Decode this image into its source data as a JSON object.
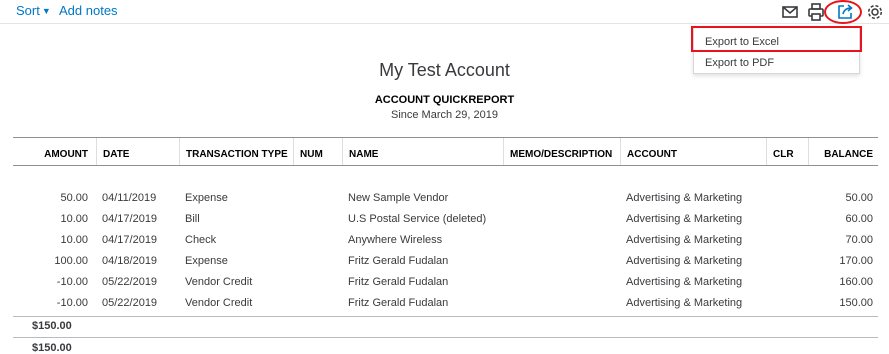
{
  "toolbar": {
    "sort_label": "Sort",
    "add_notes_label": "Add notes"
  },
  "dropdown": {
    "export_excel": "Export to Excel",
    "export_pdf": "Export to PDF"
  },
  "report": {
    "company": "My Test Account",
    "title": "ACCOUNT QUICKREPORT",
    "date_range": "Since March 29, 2019"
  },
  "table": {
    "columns": [
      "AMOUNT",
      "DATE",
      "TRANSACTION TYPE",
      "NUM",
      "NAME",
      "MEMO/DESCRIPTION",
      "ACCOUNT",
      "CLR",
      "BALANCE"
    ],
    "rows": [
      {
        "amount": "50.00",
        "date": "04/11/2019",
        "type": "Expense",
        "num": "",
        "name": "New Sample Vendor",
        "memo": "",
        "account": "Advertising & Marketing",
        "clr": "",
        "balance": "50.00"
      },
      {
        "amount": "10.00",
        "date": "04/17/2019",
        "type": "Bill",
        "num": "",
        "name": "U.S Postal Service (deleted)",
        "memo": "",
        "account": "Advertising & Marketing",
        "clr": "",
        "balance": "60.00"
      },
      {
        "amount": "10.00",
        "date": "04/17/2019",
        "type": "Check",
        "num": "",
        "name": "Anywhere Wireless",
        "memo": "",
        "account": "Advertising & Marketing",
        "clr": "",
        "balance": "70.00"
      },
      {
        "amount": "100.00",
        "date": "04/18/2019",
        "type": "Expense",
        "num": "",
        "name": "Fritz Gerald Fudalan",
        "memo": "",
        "account": "Advertising & Marketing",
        "clr": "",
        "balance": "170.00"
      },
      {
        "amount": "-10.00",
        "date": "05/22/2019",
        "type": "Vendor Credit",
        "num": "",
        "name": "Fritz Gerald Fudalan",
        "memo": "",
        "account": "Advertising & Marketing",
        "clr": "",
        "balance": "160.00"
      },
      {
        "amount": "-10.00",
        "date": "05/22/2019",
        "type": "Vendor Credit",
        "num": "",
        "name": "Fritz Gerald Fudalan",
        "memo": "",
        "account": "Advertising & Marketing",
        "clr": "",
        "balance": "150.00"
      }
    ],
    "subtotal": "$150.00",
    "grand_total": "$150.00"
  },
  "colors": {
    "link": "#0077c5",
    "highlight": "#e8141b"
  }
}
